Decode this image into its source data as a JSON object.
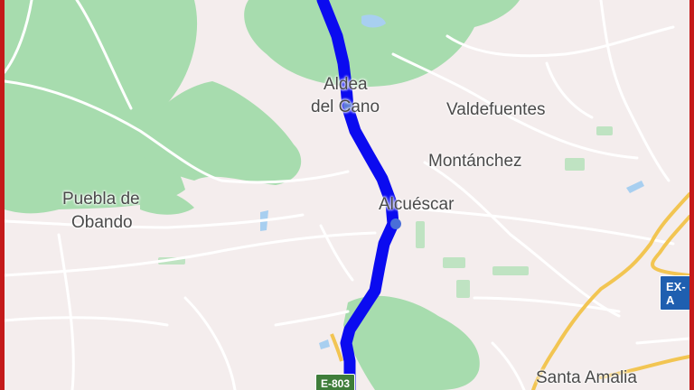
{
  "colors": {
    "route": "#0b0bf0",
    "forest": "#9fd7a4",
    "land": "#f4eded",
    "roads": "#ffffff",
    "highway": "#f2c552",
    "water": "#a8cff0",
    "frame": "#c41a1a"
  },
  "places": {
    "aldea_line1": "Aldea",
    "aldea_line2": "del Cano",
    "valdefuentes": "Valdefuentes",
    "montanchez": "Montánchez",
    "alcuescar": "Alcuéscar",
    "puebla_line1": "Puebla de",
    "puebla_line2": "Obando",
    "santa_amalia": "Santa Amalia"
  },
  "shields": {
    "e803": "E-803",
    "ex_a": "EX-A"
  }
}
